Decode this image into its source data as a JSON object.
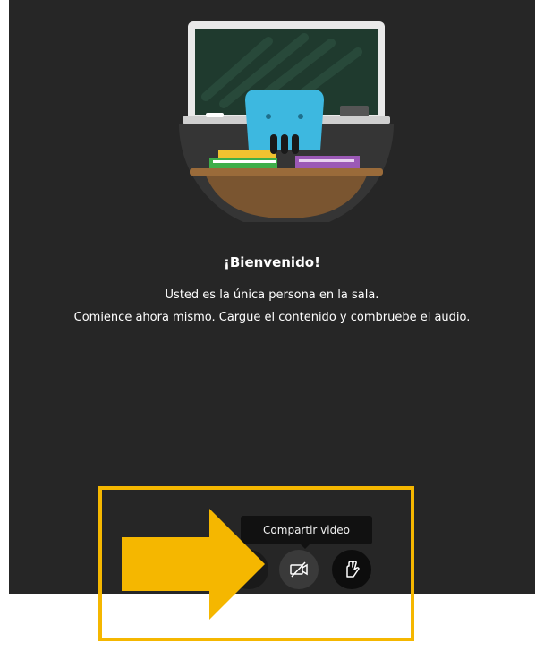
{
  "welcome": {
    "title": "¡Bienvenido!",
    "line1": "Usted es la única persona en la sala.",
    "line2": "Comience ahora mismo. Cargue el contenido y combruebe el audio."
  },
  "controls": {
    "tooltip": "Compartir video",
    "buttons": [
      {
        "name": "audio",
        "icon": "microphone-icon"
      },
      {
        "name": "video",
        "icon": "camera-off-icon"
      },
      {
        "name": "hand",
        "icon": "raise-hand-icon"
      }
    ]
  },
  "colors": {
    "background": "#262626",
    "highlight": "#f5b700",
    "chalkboard": "#1f3a2e",
    "robot": "#3db8e0",
    "desk": "#7a5530"
  }
}
